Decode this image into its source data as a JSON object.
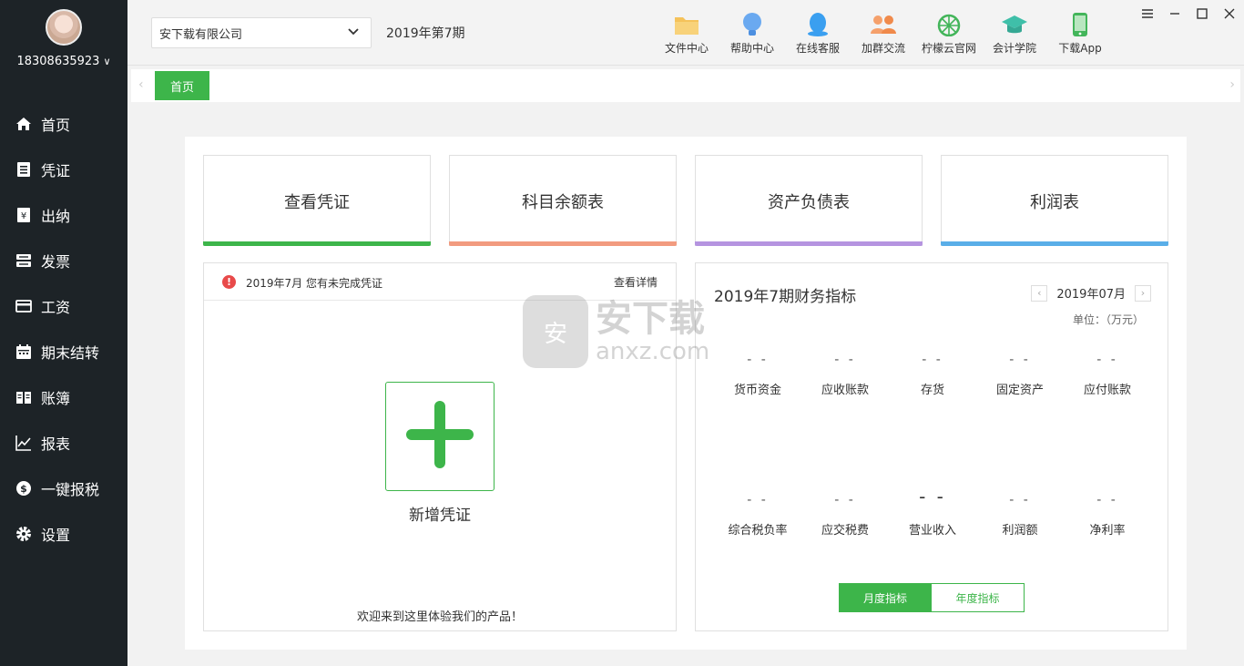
{
  "user": {
    "phone": "18308635923"
  },
  "sidebar": {
    "items": [
      {
        "label": "首页",
        "icon": "home-icon"
      },
      {
        "label": "凭证",
        "icon": "voucher-icon"
      },
      {
        "label": "出纳",
        "icon": "cashier-icon"
      },
      {
        "label": "发票",
        "icon": "invoice-icon"
      },
      {
        "label": "工资",
        "icon": "salary-icon"
      },
      {
        "label": "期末结转",
        "icon": "calendar-icon"
      },
      {
        "label": "账簿",
        "icon": "ledger-book-icon"
      },
      {
        "label": "报表",
        "icon": "chart-icon"
      },
      {
        "label": "一键报税",
        "icon": "tax-dollar-icon"
      },
      {
        "label": "设置",
        "icon": "gear-icon"
      }
    ]
  },
  "header": {
    "company": "安下载有限公司",
    "period": "2019年第7期",
    "tools": [
      {
        "label": "文件中心",
        "icon": "folder-icon",
        "color": "#f5c25a"
      },
      {
        "label": "帮助中心",
        "icon": "lightbulb-icon",
        "color": "#6aa9f0"
      },
      {
        "label": "在线客服",
        "icon": "chat-penguin-icon",
        "color": "#3a9ff0"
      },
      {
        "label": "加群交流",
        "icon": "group-icon",
        "color": "#f08a4b"
      },
      {
        "label": "柠檬云官网",
        "icon": "lemon-icon",
        "color": "#43b55a"
      },
      {
        "label": "会计学院",
        "icon": "graduation-cap-icon",
        "color": "#3fbfa9"
      },
      {
        "label": "下载App",
        "icon": "phone-icon",
        "color": "#43b55a"
      }
    ]
  },
  "tabs": {
    "home": "首页"
  },
  "quick_links": [
    {
      "label": "查看凭证",
      "color": "#3db54a"
    },
    {
      "label": "科目余额表",
      "color": "#f29b7f"
    },
    {
      "label": "资产负债表",
      "color": "#b594e0"
    },
    {
      "label": "利润表",
      "color": "#5aaee8"
    }
  ],
  "voucher_card": {
    "notice": "2019年7月 您有未完成凭证",
    "detail_link": "查看详情",
    "add_label": "新增凭证",
    "welcome": "欢迎来到这里体验我们的产品！"
  },
  "finance": {
    "title": "2019年7期财务指标",
    "month": "2019年07月",
    "unit": "单位：（万元）",
    "row1": [
      {
        "value": "- -",
        "name": "货币资金"
      },
      {
        "value": "- -",
        "name": "应收账款"
      },
      {
        "value": "- -",
        "name": "存货"
      },
      {
        "value": "- -",
        "name": "固定资产"
      },
      {
        "value": "- -",
        "name": "应付账款"
      }
    ],
    "row2": [
      {
        "value": "- -",
        "name": "综合税负率"
      },
      {
        "value": "- -",
        "name": "应交税费"
      },
      {
        "value": "- -",
        "name": "营业收入"
      },
      {
        "value": "- -",
        "name": "利润额"
      },
      {
        "value": "- -",
        "name": "净利率"
      }
    ],
    "toggle_monthly": "月度指标",
    "toggle_yearly": "年度指标"
  },
  "watermark": {
    "title": "安下载",
    "domain": "anxz.com"
  }
}
